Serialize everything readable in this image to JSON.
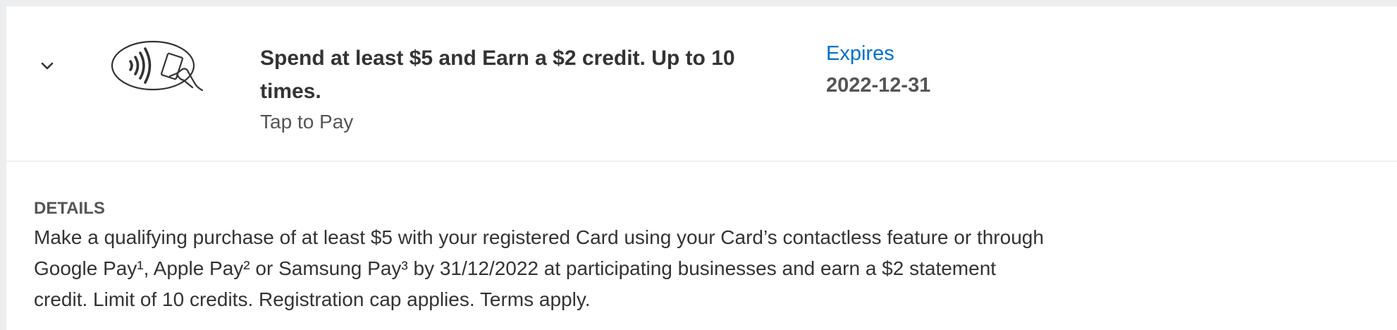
{
  "offer": {
    "toggle_icon": "chevron-down-icon",
    "logo_icon": "contactless-tap-to-pay-icon",
    "title_line1": "Spend at least $5 and Earn a $2 credit. Up to 10",
    "title_line2": "times.",
    "category": "Tap to Pay",
    "expires_label": "Expires",
    "expires_date": "2022-12-31"
  },
  "details": {
    "heading": "DETAILS",
    "line1": "Make a qualifying purchase of at least $5 with your registered Card using your Card’s contactless feature or through",
    "line2": "Google Pay¹, Apple Pay² or Samsung Pay³ by 31/12/2022 at participating businesses and earn a $2 statement",
    "line3": "credit. Limit of 10 credits. Registration cap applies. Terms apply."
  },
  "colors": {
    "accent": "#006fcf",
    "page_background": "#ecedee",
    "card_background": "#ffffff"
  }
}
